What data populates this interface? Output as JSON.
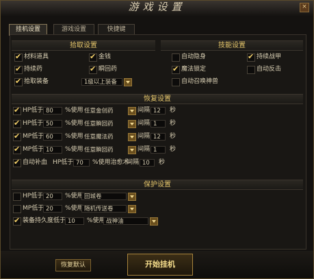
{
  "window": {
    "title": "游戏设置",
    "close": "×"
  },
  "tabs": [
    "挂机设置",
    "游戏设置",
    "快捷键"
  ],
  "pickup": {
    "title": "拾取设置",
    "items": [
      {
        "label": "材料道具",
        "checked": true
      },
      {
        "label": "金钱",
        "checked": true
      },
      {
        "label": "持续药",
        "checked": true
      },
      {
        "label": "瞬回药",
        "checked": true
      },
      {
        "label": "拾取装备",
        "checked": true
      }
    ],
    "equip_filter": "1级以上装备"
  },
  "skills": {
    "title": "技能设置",
    "items": [
      {
        "label": "自动隐身",
        "checked": false
      },
      {
        "label": "持续战甲",
        "checked": true
      },
      {
        "label": "魔法锁定",
        "checked": true
      },
      {
        "label": "自动反击",
        "checked": false
      },
      {
        "label": "自动召唤神兽",
        "checked": false
      }
    ]
  },
  "recovery": {
    "title": "恢复设置",
    "rows": [
      {
        "label": "HP低于",
        "value": "80",
        "use": "%使用",
        "item": "任意金创药",
        "interval": "间隔",
        "seconds": "12",
        "unit": "秒",
        "checked": true
      },
      {
        "label": "HP低于",
        "value": "50",
        "use": "%使用",
        "item": "任意瞬回药",
        "interval": "间隔",
        "seconds": "1",
        "unit": "秒",
        "checked": true
      },
      {
        "label": "MP低于",
        "value": "60",
        "use": "%使用",
        "item": "任意魔法药",
        "interval": "间隔",
        "seconds": "12",
        "unit": "秒",
        "checked": true
      },
      {
        "label": "MP低于",
        "value": "10",
        "use": "%使用",
        "item": "任意瞬回药",
        "interval": "间隔",
        "seconds": "1",
        "unit": "秒",
        "checked": true
      }
    ],
    "auto_heal": {
      "label": "自动补血",
      "hp": "HP低于",
      "value": "70",
      "use": "%使用治愈术",
      "interval": "间隔",
      "seconds": "10",
      "unit": "秒",
      "checked": true
    }
  },
  "protect": {
    "title": "保护设置",
    "rows": [
      {
        "label": "HP低于",
        "value": "20",
        "use": "%使用",
        "item": "回城卷",
        "checked": false
      },
      {
        "label": "MP低于",
        "value": "20",
        "use": "%使用",
        "item": "随机传送卷",
        "checked": false
      },
      {
        "label": "装备持久度低于",
        "value": "10",
        "use": "%使用",
        "item": "战神油",
        "checked": true
      }
    ]
  },
  "buttons": {
    "reset": "恢复默认",
    "start": "开始挂机"
  }
}
